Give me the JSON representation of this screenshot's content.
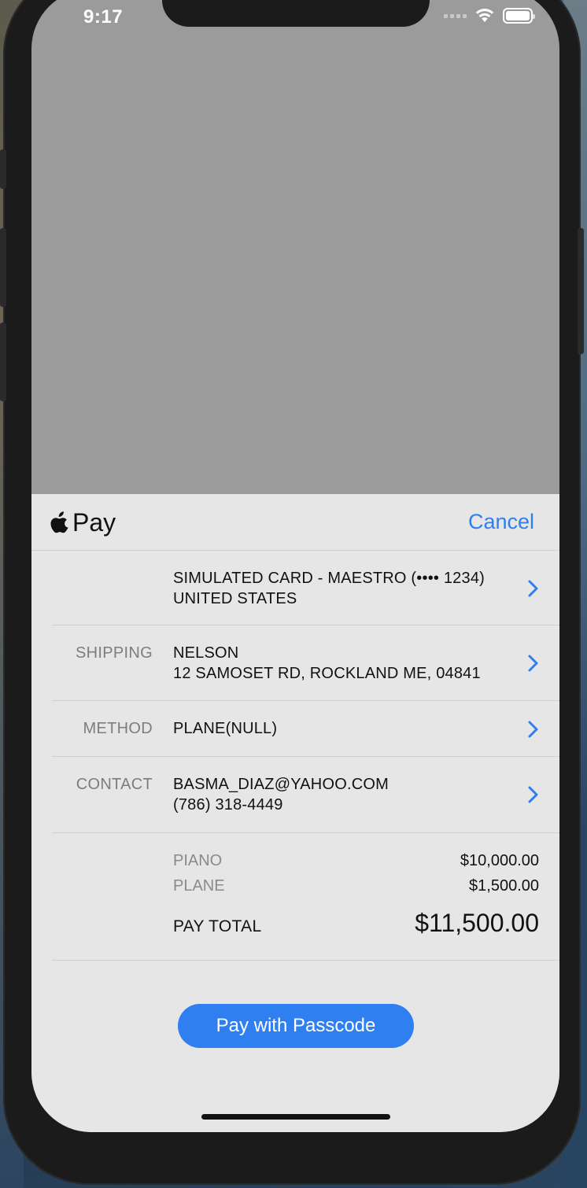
{
  "status_bar": {
    "time": "9:17"
  },
  "sheet": {
    "brand": "Pay",
    "cancel_label": "Cancel",
    "card": {
      "line1": "SIMULATED CARD - MAESTRO (•••• 1234)",
      "line2": "UNITED STATES"
    },
    "shipping": {
      "label": "SHIPPING",
      "line1": "NELSON",
      "line2": "12 SAMOSET RD, ROCKLAND ME, 04841"
    },
    "method": {
      "label": "METHOD",
      "value": "PLANE(NULL)"
    },
    "contact": {
      "label": "CONTACT",
      "email": "BASMA_DIAZ@YAHOO.COM",
      "phone": "(786) 318-4449"
    },
    "line_items": [
      {
        "name": "PIANO",
        "amount": "$10,000.00"
      },
      {
        "name": "PLANE",
        "amount": "$1,500.00"
      }
    ],
    "total": {
      "label": "PAY TOTAL",
      "amount": "$11,500.00"
    },
    "pay_button_label": "Pay with Passcode"
  },
  "colors": {
    "accent": "#2f7ff0",
    "sheet_bg": "#e6e6e6",
    "dim_overlay": "#9b9b9b"
  }
}
